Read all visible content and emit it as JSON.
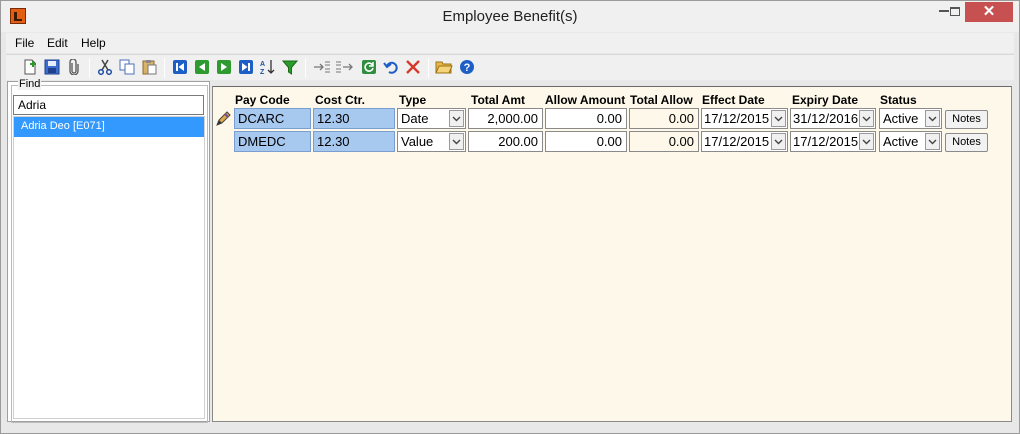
{
  "window": {
    "title": "Employee Benefit(s)",
    "close_glyph": "✕"
  },
  "menu": [
    "File",
    "Edit",
    "Help"
  ],
  "toolbar": {
    "icons": [
      "new-icon",
      "save-icon",
      "attach-icon",
      "cut-icon",
      "copy-icon",
      "paste-icon",
      "first-record-icon",
      "previous-record-icon",
      "next-record-icon",
      "last-record-icon",
      "sort-icon",
      "filter-icon",
      "indent-icon",
      "outdent-icon",
      "refresh-icon",
      "undo-icon",
      "delete-icon",
      "open-folder-icon",
      "help-icon"
    ]
  },
  "find": {
    "label": "Find",
    "value": "Adria",
    "results": [
      "Adria  Deo [E071]"
    ]
  },
  "grid": {
    "headers": [
      "Pay Code",
      "Cost Ctr.",
      "Type",
      "Total Amt",
      "Allow Amount",
      "Total Allow",
      "Effect Date",
      "Expiry Date",
      "Status"
    ],
    "rows": [
      {
        "pay_code": "DCARC",
        "cost_ctr": "12.30",
        "type": "Date",
        "total_amt": "2,000.00",
        "allow_amount": "0.00",
        "total_allow": "0.00",
        "effect_date": "17/12/2015",
        "expiry_date": "31/12/2016",
        "status": "Active",
        "notes": "Notes"
      },
      {
        "pay_code": "DMEDC",
        "cost_ctr": "12.30",
        "type": "Value",
        "total_amt": "200.00",
        "allow_amount": "0.00",
        "total_allow": "0.00",
        "effect_date": "17/12/2015",
        "expiry_date": "17/12/2015",
        "status": "Active",
        "notes": "Notes"
      }
    ]
  },
  "colors": {
    "selection": "#3399ff",
    "key_cell": "#a7c8ef",
    "grid_background": "#fdf8ea",
    "close_button": "#c75050"
  }
}
